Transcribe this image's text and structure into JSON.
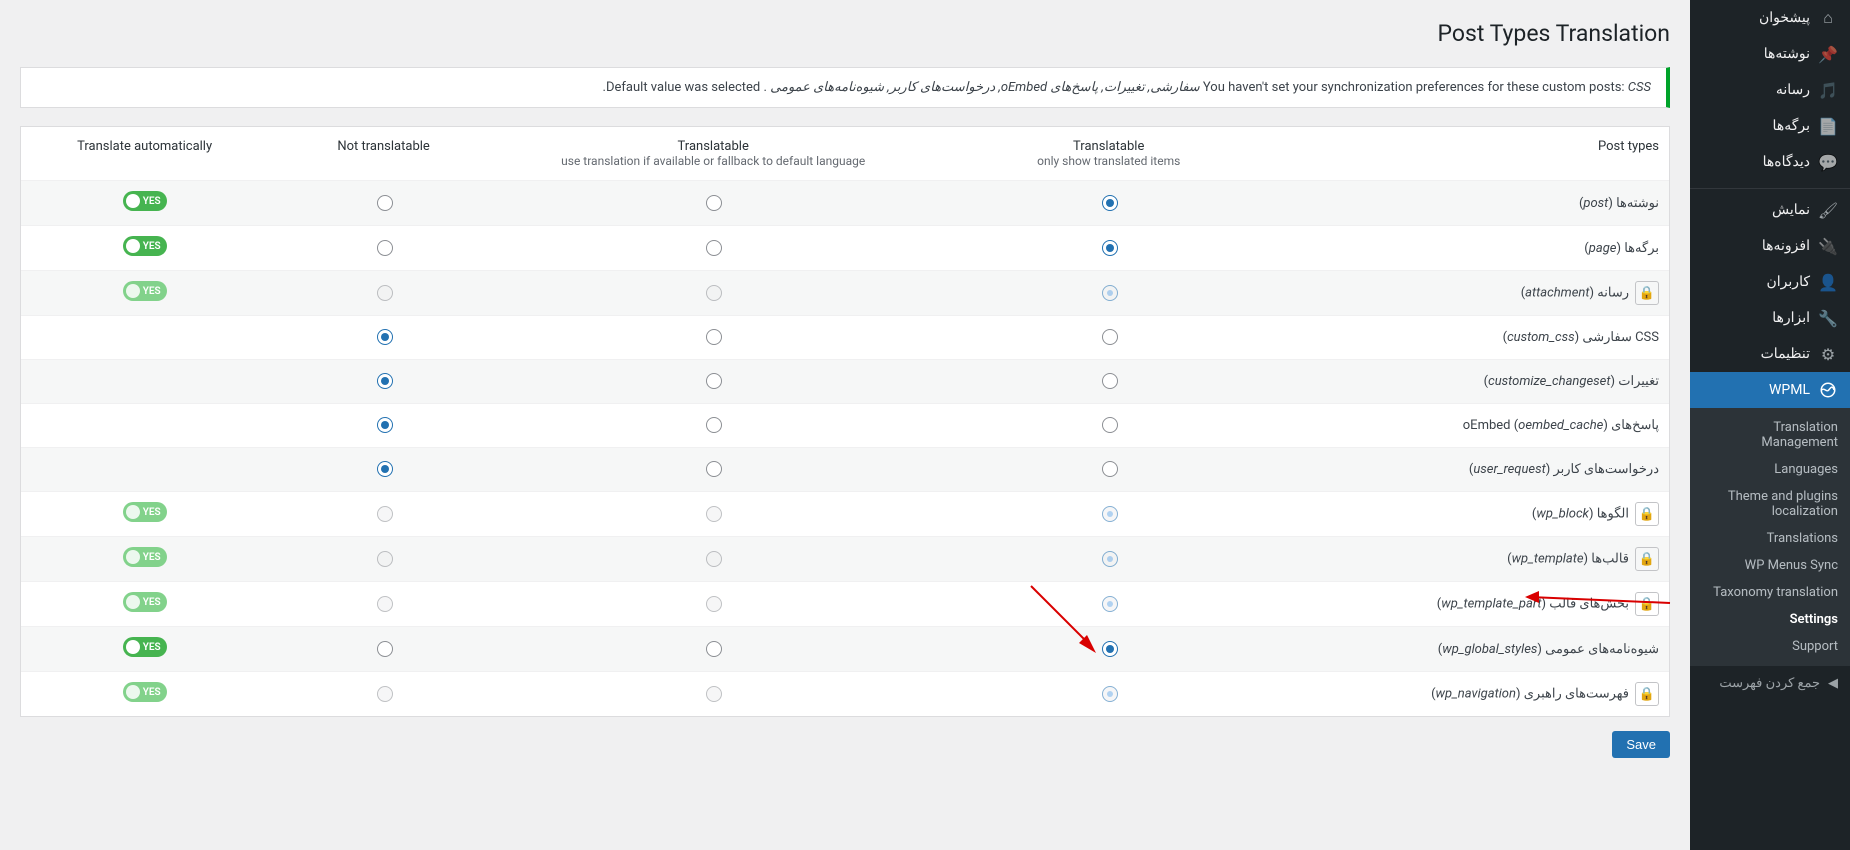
{
  "sidebar": {
    "items": [
      {
        "label": "پیشخوان",
        "icon": "dashboard"
      },
      {
        "label": "نوشته‌ها",
        "icon": "pin"
      },
      {
        "label": "رسانه",
        "icon": "media"
      },
      {
        "label": "برگه‌ها",
        "icon": "page"
      },
      {
        "label": "دیدگاه‌ها",
        "icon": "comment"
      },
      {
        "label": "نمایش",
        "icon": "appearance"
      },
      {
        "label": "افزونه‌ها",
        "icon": "plugin"
      },
      {
        "label": "کاربران",
        "icon": "user"
      },
      {
        "label": "ابزارها",
        "icon": "tools"
      },
      {
        "label": "تنظیمات",
        "icon": "settings"
      }
    ],
    "active": {
      "label": "WPML",
      "icon": "wpml"
    },
    "submenu": [
      {
        "label": "Translation Management"
      },
      {
        "label": "Languages"
      },
      {
        "label": "Theme and plugins localization"
      },
      {
        "label": "Translations"
      },
      {
        "label": "WP Menus Sync"
      },
      {
        "label": "Taxonomy translation"
      },
      {
        "label": "Settings",
        "current": true
      },
      {
        "label": "Support"
      }
    ],
    "collapse_label": "جمع کردن فهرست"
  },
  "page_title": "Post Types Translation",
  "notice": {
    "pre": "You haven't set your synchronization preferences for these custom posts:",
    "list": "CSS سفارشی, تغییرات, پاسخ‌های oEmbed, درخواست‌های کاربر, شیوه‌نامه‌های عمومی",
    "post": ". Default value was selected."
  },
  "columns": {
    "post_types": "Post types",
    "translatable": "Translatable",
    "translatable_sub": "only show translated items",
    "translatable_fallback": "Translatable",
    "translatable_fallback_sub": "use translation if available or fallback to default language",
    "not_translatable": "Not translatable",
    "auto": "Translate automatically"
  },
  "toggle_yes": "YES",
  "save_label": "Save",
  "rows": [
    {
      "name": "نوشته‌ها",
      "slug": "post",
      "locked": false,
      "selected": "translatable",
      "auto": "on"
    },
    {
      "name": "برگه‌ها",
      "slug": "page",
      "locked": false,
      "selected": "translatable",
      "auto": "on"
    },
    {
      "name": "رسانه",
      "slug": "attachment",
      "locked": true,
      "selected": "translatable",
      "auto": "on_light"
    },
    {
      "name": "CSS سفارشی",
      "slug": "custom_css",
      "locked": false,
      "selected": "not",
      "auto": null
    },
    {
      "name": "تغییرات",
      "slug": "customize_changeset",
      "locked": false,
      "selected": "not",
      "auto": null
    },
    {
      "name": "پاسخ‌های oEmbed",
      "slug": "oembed_cache",
      "locked": false,
      "selected": "not",
      "auto": null
    },
    {
      "name": "درخواست‌های کاربر",
      "slug": "user_request",
      "locked": false,
      "selected": "not",
      "auto": null
    },
    {
      "name": "الگوها",
      "slug": "wp_block",
      "locked": true,
      "selected": "translatable",
      "auto": "on_light"
    },
    {
      "name": "قالب‌ها",
      "slug": "wp_template",
      "locked": true,
      "selected": "translatable",
      "auto": "on_light"
    },
    {
      "name": "بخش‌های قالب",
      "slug": "wp_template_part",
      "locked": true,
      "selected": "translatable",
      "auto": "on_light"
    },
    {
      "name": "شیوه‌نامه‌های عمومی",
      "slug": "wp_global_styles",
      "locked": false,
      "selected": "translatable",
      "auto": "on",
      "arrow": true
    },
    {
      "name": "فهرست‌های راهبری",
      "slug": "wp_navigation",
      "locked": true,
      "selected": "translatable",
      "auto": "on_light"
    }
  ]
}
